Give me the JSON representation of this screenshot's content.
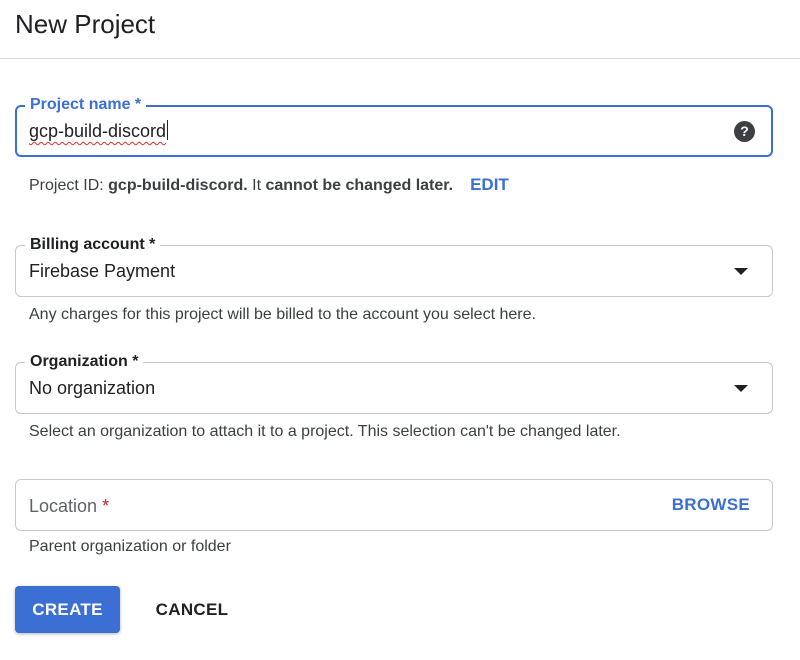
{
  "page_title": "New Project",
  "project_name": {
    "label": "Project name *",
    "value": "gcp-build-discord",
    "help_icon": "?",
    "hint_prefix": "Project ID: ",
    "hint_project_id": "gcp-build-discord.",
    "hint_middle": " It ",
    "hint_emphasis": "cannot be changed later.",
    "edit_label": "EDIT"
  },
  "billing_account": {
    "label": "Billing account *",
    "value": "Firebase Payment",
    "hint": "Any charges for this project will be billed to the account you select here."
  },
  "organization": {
    "label": "Organization *",
    "value": "No organization",
    "hint": "Select an organization to attach it to a project. This selection can't be changed later."
  },
  "location": {
    "label": "Location",
    "required_mark": "*",
    "browse_label": "BROWSE",
    "hint": "Parent organization or folder"
  },
  "actions": {
    "create_label": "CREATE",
    "cancel_label": "CANCEL"
  },
  "colors": {
    "accent": "#3b6fd4",
    "required": "#c5221f",
    "border": "#c6c8cc"
  }
}
